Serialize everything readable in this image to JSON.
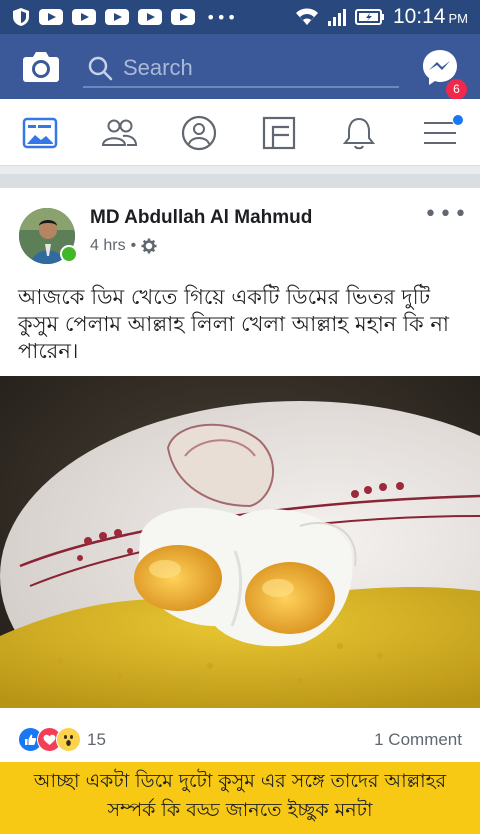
{
  "status_bar": {
    "time": "10:14",
    "ampm": "PM",
    "icons": [
      "shield-icon",
      "youtube-icon",
      "youtube-icon",
      "youtube-icon",
      "youtube-icon",
      "youtube-icon",
      "more-dots",
      "wifi-icon",
      "signal-icon",
      "battery-icon"
    ]
  },
  "header": {
    "search_placeholder": "Search",
    "messenger_badge": "6"
  },
  "nav": {
    "items": [
      "news-feed-icon",
      "friends-icon",
      "profile-icon",
      "pages-icon",
      "notifications-icon",
      "menu-icon"
    ]
  },
  "post": {
    "author": "MD Abdullah Al Mahmud",
    "time": "4 hrs",
    "separator": "•",
    "text": "আজকে ডিম খেতে গিয়ে একটি ডিমের ভিতর দুটি কুসুম পেলাম আল্লাহ লিলা খেলা আল্লাহ মহান কি না পারেন।",
    "reaction_count": "15",
    "comments": "1 Comment",
    "caption": "আচ্ছা একটা ডিমে দুটো কুসুম এর সঙ্গে তাদের আল্লাহর সম্পর্ক কি বড্ড জানতে ইচ্ছুক মনটা"
  },
  "colors": {
    "facebook_blue": "#3b5998",
    "status_bar": "#29487d",
    "caption_yellow": "#f7c914",
    "badge_red": "#f02849"
  }
}
